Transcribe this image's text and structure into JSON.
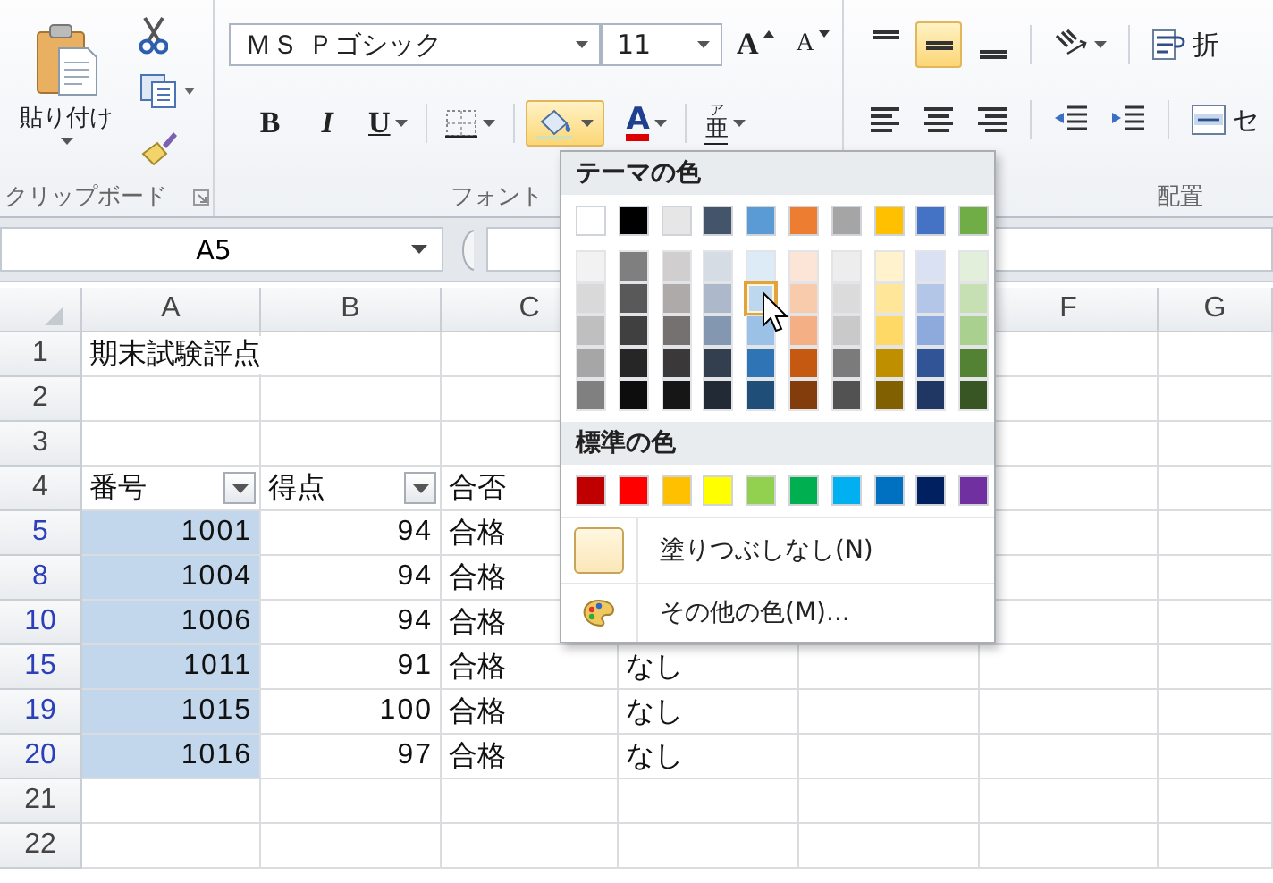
{
  "clipboard": {
    "paste_label": "貼り付け",
    "group_label": "クリップボード"
  },
  "font": {
    "family": "ＭＳ Ｐゴシック",
    "size": "11",
    "grow_label": "A",
    "shrink_label": "A",
    "bold_label": "B",
    "italic_label": "I",
    "underline_label": "U",
    "fill_pressed": true,
    "color_label": "A",
    "phonetic_label": "亜",
    "phonetic_ruby": "ア",
    "group_label": "フォント"
  },
  "alignment": {
    "vertical": [
      {
        "kind": "top",
        "selected": false
      },
      {
        "kind": "middle",
        "selected": true
      },
      {
        "kind": "bottom",
        "selected": false
      }
    ],
    "horizontal": [
      {
        "kind": "left"
      },
      {
        "kind": "center"
      },
      {
        "kind": "right"
      }
    ],
    "wrap_label": "折",
    "merge_label": "セ",
    "group_label": "配置"
  },
  "formula_bar": {
    "name_box": "A5"
  },
  "sheet": {
    "columns": [
      {
        "label": "A"
      },
      {
        "label": "B"
      },
      {
        "label": "C"
      },
      {},
      {},
      {
        "label": "F"
      },
      {
        "label": "G"
      }
    ],
    "rows": [
      {
        "header": "1",
        "filtered": false,
        "cells": [
          {
            "text": "期末試験評点",
            "kind": "text",
            "selected": false
          },
          {
            "selected": false
          },
          {
            "selected": false
          },
          {},
          {},
          {
            "selected": false
          },
          {
            "selected": false
          }
        ]
      },
      {
        "header": "2",
        "filtered": false,
        "cells": [
          {
            "selected": false
          },
          {
            "selected": false
          },
          {
            "selected": false
          },
          {},
          {},
          {
            "selected": false
          },
          {
            "selected": false
          }
        ]
      },
      {
        "header": "3",
        "filtered": false,
        "cells": [
          {
            "selected": false
          },
          {
            "selected": false
          },
          {
            "selected": false
          },
          {},
          {},
          {
            "selected": false
          },
          {
            "selected": false
          }
        ]
      },
      {
        "header": "4",
        "filtered": false,
        "cells": [
          {
            "text": "番号",
            "kind": "text",
            "filter": true,
            "selected": false
          },
          {
            "text": "得点",
            "kind": "text",
            "filter": true,
            "selected": false
          },
          {
            "text": "合否",
            "kind": "text",
            "selected": false
          },
          {},
          {},
          {
            "selected": false
          },
          {
            "selected": false
          }
        ]
      },
      {
        "header": "5",
        "filtered": true,
        "cells": [
          {
            "text": "1001",
            "kind": "number",
            "selected": true
          },
          {
            "text": "94",
            "kind": "number",
            "selected": false
          },
          {
            "text": "合格",
            "kind": "text",
            "selected": false
          },
          {},
          {},
          {
            "selected": false
          },
          {
            "selected": false
          }
        ]
      },
      {
        "header": "8",
        "filtered": true,
        "cells": [
          {
            "text": "1004",
            "kind": "number",
            "selected": true
          },
          {
            "text": "94",
            "kind": "number",
            "selected": false
          },
          {
            "text": "合格",
            "kind": "text",
            "selected": false
          },
          {},
          {},
          {
            "selected": false
          },
          {
            "selected": false
          }
        ]
      },
      {
        "header": "10",
        "filtered": true,
        "cells": [
          {
            "text": "1006",
            "kind": "number",
            "selected": true
          },
          {
            "text": "94",
            "kind": "number",
            "selected": false
          },
          {
            "text": "合格",
            "kind": "text",
            "selected": false
          },
          {},
          {},
          {
            "selected": false
          },
          {
            "selected": false
          }
        ]
      },
      {
        "header": "15",
        "filtered": true,
        "cells": [
          {
            "text": "1011",
            "kind": "number",
            "selected": true
          },
          {
            "text": "91",
            "kind": "number",
            "selected": false
          },
          {
            "text": "合格",
            "kind": "text",
            "selected": false
          },
          {
            "text": "なし",
            "kind": "text",
            "selected": false
          },
          {
            "selected": false
          },
          {
            "selected": false
          },
          {
            "selected": false
          }
        ]
      },
      {
        "header": "19",
        "filtered": true,
        "cells": [
          {
            "text": "1015",
            "kind": "number",
            "selected": true
          },
          {
            "text": "100",
            "kind": "number",
            "selected": false
          },
          {
            "text": "合格",
            "kind": "text",
            "selected": false
          },
          {
            "text": "なし",
            "kind": "text",
            "selected": false
          },
          {
            "selected": false
          },
          {
            "selected": false
          },
          {
            "selected": false
          }
        ]
      },
      {
        "header": "20",
        "filtered": true,
        "cells": [
          {
            "text": "1016",
            "kind": "number",
            "selected": true
          },
          {
            "text": "97",
            "kind": "number",
            "selected": false
          },
          {
            "text": "合格",
            "kind": "text",
            "selected": false
          },
          {
            "text": "なし",
            "kind": "text",
            "selected": false
          },
          {
            "selected": false
          },
          {
            "selected": false
          },
          {
            "selected": false
          }
        ]
      },
      {
        "header": "21",
        "filtered": false,
        "cells": [
          {
            "selected": false
          },
          {
            "selected": false
          },
          {
            "selected": false
          },
          {
            "selected": false
          },
          {
            "selected": false
          },
          {
            "selected": false
          },
          {
            "selected": false
          }
        ]
      },
      {
        "header": "22",
        "filtered": false,
        "cells": [
          {
            "selected": false
          },
          {
            "selected": false
          },
          {
            "selected": false
          },
          {
            "selected": false
          },
          {
            "selected": false
          },
          {
            "selected": false
          },
          {
            "selected": false
          }
        ]
      }
    ]
  },
  "fill_menu": {
    "theme_title": "テーマの色",
    "theme_colors": [
      {
        "color": "#ffffff",
        "shades": [
          {
            "color": "#f2f2f2",
            "highlighted": false
          },
          {
            "color": "#d9d9d9",
            "highlighted": false
          },
          {
            "color": "#bfbfbf",
            "highlighted": false
          },
          {
            "color": "#a6a6a6",
            "highlighted": false
          },
          {
            "color": "#808080",
            "highlighted": false
          }
        ]
      },
      {
        "color": "#000000",
        "shades": [
          {
            "color": "#7f7f7f",
            "highlighted": false
          },
          {
            "color": "#595959",
            "highlighted": false
          },
          {
            "color": "#404040",
            "highlighted": false
          },
          {
            "color": "#262626",
            "highlighted": false
          },
          {
            "color": "#0d0d0d",
            "highlighted": false
          }
        ]
      },
      {
        "color": "#e7e6e6",
        "shades": [
          {
            "color": "#d0cece",
            "highlighted": false
          },
          {
            "color": "#aeaaaa",
            "highlighted": false
          },
          {
            "color": "#757171",
            "highlighted": false
          },
          {
            "color": "#3a3838",
            "highlighted": false
          },
          {
            "color": "#171616",
            "highlighted": false
          }
        ]
      },
      {
        "color": "#44546a",
        "shades": [
          {
            "color": "#d6dce4",
            "highlighted": false
          },
          {
            "color": "#adb9ca",
            "highlighted": false
          },
          {
            "color": "#8497b0",
            "highlighted": false
          },
          {
            "color": "#333f4f",
            "highlighted": false
          },
          {
            "color": "#222a35",
            "highlighted": false
          }
        ]
      },
      {
        "color": "#5b9bd5",
        "shades": [
          {
            "color": "#ddebf7",
            "highlighted": false
          },
          {
            "color": "#bdd7ee",
            "highlighted": true
          },
          {
            "color": "#9bc2e6",
            "highlighted": false
          },
          {
            "color": "#2f75b5",
            "highlighted": false
          },
          {
            "color": "#1f4e78",
            "highlighted": false
          }
        ]
      },
      {
        "color": "#ed7d31",
        "shades": [
          {
            "color": "#fce4d6",
            "highlighted": false
          },
          {
            "color": "#f8cbad",
            "highlighted": false
          },
          {
            "color": "#f4b084",
            "highlighted": false
          },
          {
            "color": "#c65911",
            "highlighted": false
          },
          {
            "color": "#833c0c",
            "highlighted": false
          }
        ]
      },
      {
        "color": "#a5a5a5",
        "shades": [
          {
            "color": "#ededed",
            "highlighted": false
          },
          {
            "color": "#dbdbdb",
            "highlighted": false
          },
          {
            "color": "#c9c9c9",
            "highlighted": false
          },
          {
            "color": "#7b7b7b",
            "highlighted": false
          },
          {
            "color": "#525252",
            "highlighted": false
          }
        ]
      },
      {
        "color": "#ffc000",
        "shades": [
          {
            "color": "#fff2cc",
            "highlighted": false
          },
          {
            "color": "#ffe699",
            "highlighted": false
          },
          {
            "color": "#ffd966",
            "highlighted": false
          },
          {
            "color": "#bf8f00",
            "highlighted": false
          },
          {
            "color": "#806000",
            "highlighted": false
          }
        ]
      },
      {
        "color": "#4472c4",
        "shades": [
          {
            "color": "#d9e1f2",
            "highlighted": false
          },
          {
            "color": "#b4c6e7",
            "highlighted": false
          },
          {
            "color": "#8ea9db",
            "highlighted": false
          },
          {
            "color": "#305496",
            "highlighted": false
          },
          {
            "color": "#203764",
            "highlighted": false
          }
        ]
      },
      {
        "color": "#70ad47",
        "shades": [
          {
            "color": "#e2efda",
            "highlighted": false
          },
          {
            "color": "#c6e0b4",
            "highlighted": false
          },
          {
            "color": "#a9d08e",
            "highlighted": false
          },
          {
            "color": "#548235",
            "highlighted": false
          },
          {
            "color": "#375623",
            "highlighted": false
          }
        ]
      }
    ],
    "standard_title": "標準の色",
    "standard_colors": [
      {
        "color": "#c00000"
      },
      {
        "color": "#ff0000"
      },
      {
        "color": "#ffc000"
      },
      {
        "color": "#ffff00"
      },
      {
        "color": "#92d050"
      },
      {
        "color": "#00b050"
      },
      {
        "color": "#00b0f0"
      },
      {
        "color": "#0070c0"
      },
      {
        "color": "#002060"
      },
      {
        "color": "#7030a0"
      }
    ],
    "no_fill_label": "塗りつぶしなし(N)",
    "more_colors_label": "その他の色(M)..."
  }
}
